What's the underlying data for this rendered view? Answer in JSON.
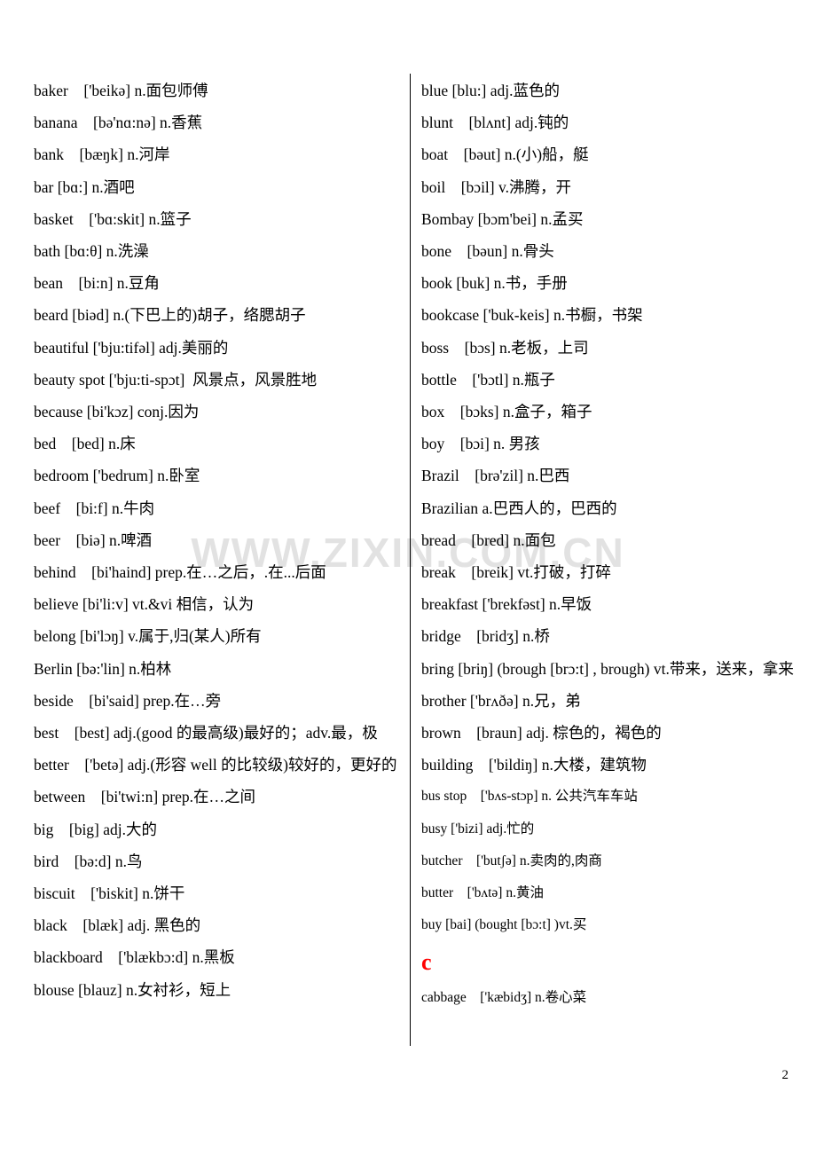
{
  "document": {
    "page_number": "2",
    "watermark": "WWW.ZIXIN.COM.CN"
  },
  "left_column": {
    "entries": [
      "baker    ['beikə] n.面包师傅",
      "banana    [bə'nɑ:nə] n.香蕉",
      "bank    [bæŋk] n.河岸",
      "bar [bɑ:] n.酒吧",
      "basket    ['bɑ:skit] n.篮子",
      "bath [bɑ:θ] n.洗澡",
      "bean    [bi:n] n.豆角",
      "beard [biəd] n.(下巴上的)胡子，络腮胡子",
      "beautiful ['bju:tifəl] adj.美丽的",
      "beauty spot ['bju:ti-spɔt]  风景点，风景胜地",
      "because [bi'kɔz] conj.因为",
      "bed    [bed] n.床",
      "bedroom ['bedrum] n.卧室",
      "beef    [bi:f] n.牛肉",
      "beer    [biə] n.啤酒",
      "behind    [bi'haind] prep.在…之后，.在...后面",
      "believe [bi'li:v] vt.&vi 相信，认为",
      "belong [bi'lɔŋ] v.属于,归(某人)所有",
      "Berlin [bə:'lin] n.柏林",
      "beside    [bi'said] prep.在…旁",
      "best    [best] adj.(good 的最高级)最好的；adv.最，极",
      "better    ['betə] adj.(形容 well 的比较级)较好的，更好的",
      "between    [bi'twi:n] prep.在…之间",
      "big    [big] adj.大的",
      "bird    [bə:d] n.鸟",
      "biscuit    ['biskit] n.饼干",
      "black    [blæk] adj. 黑色的",
      "blackboard    ['blækbɔ:d] n.黑板",
      "blouse [blauz] n.女衬衫，短上"
    ]
  },
  "right_column": {
    "entries": [
      {
        "text": "blue [blu:] adj.蓝色的",
        "size": "normal"
      },
      {
        "text": "blunt    [blʌnt] adj.钝的",
        "size": "normal"
      },
      {
        "text": "boat    [bəut] n.(小)船，艇",
        "size": "normal"
      },
      {
        "text": "boil    [bɔil] v.沸腾，开",
        "size": "normal"
      },
      {
        "text": "Bombay [bɔm'bei] n.孟买",
        "size": "normal"
      },
      {
        "text": "bone    [bəun] n.骨头",
        "size": "normal"
      },
      {
        "text": "book [buk] n.书，手册",
        "size": "normal"
      },
      {
        "text": "bookcase ['buk-keis] n.书橱，书架",
        "size": "normal"
      },
      {
        "text": "boss    [bɔs] n.老板，上司",
        "size": "normal"
      },
      {
        "text": "bottle    ['bɔtl] n.瓶子",
        "size": "normal"
      },
      {
        "text": "box    [bɔks] n.盒子，箱子",
        "size": "normal"
      },
      {
        "text": "boy    [bɔi] n. 男孩",
        "size": "normal"
      },
      {
        "text": "Brazil    [brə'zil] n.巴西",
        "size": "normal"
      },
      {
        "text": "Brazilian a.巴西人的，巴西的",
        "size": "normal"
      },
      {
        "text": "bread    [bred] n.面包",
        "size": "normal"
      },
      {
        "text": "break    [breik] vt.打破，打碎",
        "size": "normal"
      },
      {
        "text": "breakfast ['brekfəst] n.早饭",
        "size": "normal"
      },
      {
        "text": "bridge    [bridʒ] n.桥",
        "size": "normal"
      },
      {
        "text": "bring [briŋ] (brough [brɔ:t] , brough) vt.带来，送来，拿来",
        "size": "normal"
      },
      {
        "text": "brother ['brʌðə] n.兄，弟",
        "size": "normal"
      },
      {
        "text": "brown    [braun] adj. 棕色的，褐色的",
        "size": "normal"
      },
      {
        "text": "building    ['bildiŋ] n.大楼，建筑物",
        "size": "normal"
      },
      {
        "text": "bus stop    ['bʌs-stɔp] n. 公共汽车车站",
        "size": "small"
      },
      {
        "text": "busy ['bizi] adj.忙的",
        "size": "small"
      },
      {
        "text": "butcher    ['butʃə] n.卖肉的,肉商",
        "size": "small"
      },
      {
        "text": "butter    ['bʌtə] n.黄油",
        "size": "small"
      },
      {
        "text": "buy [bai] (bought [bɔ:t] )vt.买",
        "size": "small"
      }
    ],
    "section_letter": "c",
    "entries_after_letter": [
      {
        "text": "cabbage    ['kæbidʒ] n.卷心菜",
        "size": "small"
      }
    ]
  }
}
